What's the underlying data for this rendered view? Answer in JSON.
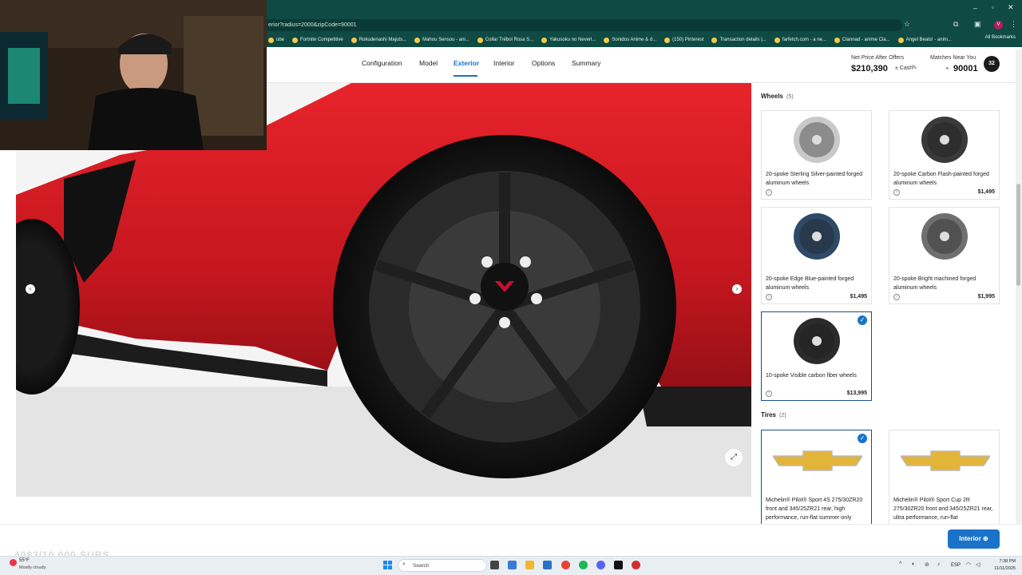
{
  "browser": {
    "url": "erior?radius=2000&zipCode=90001",
    "bookmarks": [
      "ube",
      "Fortnite Competitive",
      "Rokudenashi Majuts...",
      "Mahou Sensou - ani...",
      "Collar Trébol Rosa S...",
      "Yakusoku no Neverl...",
      "Sonidos Anime & d...",
      "(150) Pinterest",
      "Transaction details |...",
      "farfetch.com - a ne...",
      "Clannad - anime Cla...",
      "Angel Beats! - anim..."
    ],
    "all_bookmarks": "All Bookmarks",
    "profile_initial": "V"
  },
  "nav": {
    "tabs": [
      "Configuration",
      "Model",
      "Exterior",
      "Interior",
      "Options",
      "Summary"
    ],
    "active_tab": "Exterior",
    "price_label": "Net Price After Offers",
    "price_value": "$210,390",
    "price_suffix": "± Cash",
    "matches_label": "Matches Near You",
    "matches_zip": "90001",
    "count_badge": "32"
  },
  "panel": {
    "wheels_title": "Wheels",
    "wheels_count": "(5)",
    "wheels": [
      {
        "name": "20-spoke Sterling Silver-painted forged aluminum wheels",
        "price": "",
        "selected": false,
        "color": "#c9c9c9"
      },
      {
        "name": "20-spoke Carbon Flash-painted forged aluminum wheels",
        "price": "$1,495",
        "selected": false,
        "color": "#3a3a3a"
      },
      {
        "name": "20-spoke Edge Blue-painted forged aluminum wheels",
        "price": "$1,495",
        "selected": false,
        "color": "#2f4a66"
      },
      {
        "name": "20-spoke Bright machined forged aluminum wheels",
        "price": "$1,995",
        "selected": false,
        "color": "#6f6f6f"
      },
      {
        "name": "10-spoke Visible carbon fiber wheels",
        "price": "$13,995",
        "selected": true,
        "color": "#2b2b2b"
      }
    ],
    "tires_title": "Tires",
    "tires_count": "(2)",
    "tires": [
      {
        "name": "Michelin® Pilot® Sport 4S 275/30ZR20 front and 345/25ZR21 rear, high performance, run-flat summer-only",
        "selected": true
      },
      {
        "name": "Michelin® Pilot® Sport Cup 2R 275/30ZR20 front and 345/25ZR21 rear, ultra performance, run-flat",
        "selected": false
      }
    ],
    "check_glyph": "✓",
    "info_glyph": "i"
  },
  "bottom": {
    "interior_button": "Interior ⊕",
    "subs_overlay": "4083/10,000 SUBS"
  },
  "taskbar": {
    "temp": "55°F",
    "weather": "Mostly cloudy",
    "search_placeholder": "Search",
    "lang": "ESP",
    "time": "7:38 PM",
    "date": "11/11/2025"
  },
  "colors": {
    "accent": "#1a73c8",
    "chrome": "#0f4a44",
    "car_red": "#d81f26"
  }
}
